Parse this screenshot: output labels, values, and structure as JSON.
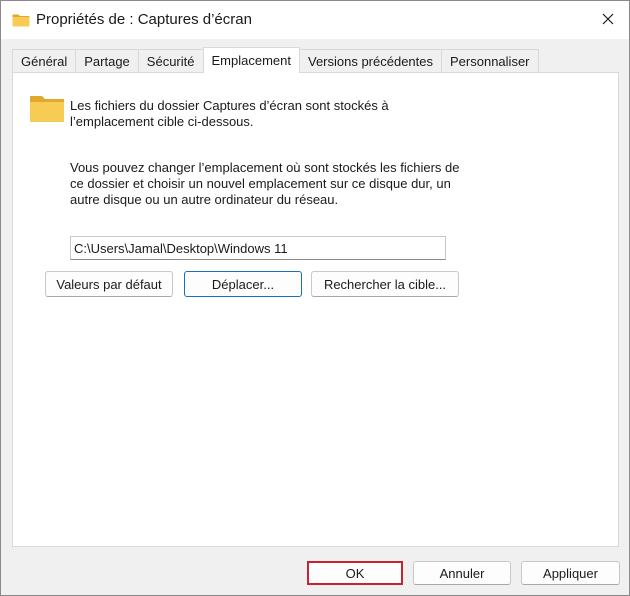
{
  "window": {
    "title": "Propriétés de : Captures d’écran"
  },
  "tabs": [
    {
      "label": "Général"
    },
    {
      "label": "Partage"
    },
    {
      "label": "Sécurité"
    },
    {
      "label": "Emplacement",
      "active": true
    },
    {
      "label": "Versions précédentes"
    },
    {
      "label": "Personnaliser"
    }
  ],
  "panel": {
    "info_text": "Les fichiers du dossier Captures d’écran sont stockés à l’emplacement cible ci-dessous.",
    "description": "Vous pouvez changer l’emplacement où sont stockés les fichiers de ce dossier et choisir un nouvel emplacement sur ce disque dur, un autre disque ou un autre ordinateur du réseau.",
    "path_value": "C:\\Users\\Jamal\\Desktop\\Windows 11",
    "buttons": {
      "default_label": "Valeurs par défaut",
      "move_label": "Déplacer...",
      "find_target_label": "Rechercher la cible..."
    }
  },
  "footer": {
    "ok_label": "OK",
    "cancel_label": "Annuler",
    "apply_label": "Appliquer"
  },
  "colors": {
    "folder": "#f5c84a",
    "focus_border": "#1a6ec0",
    "highlight_border": "#c8242f"
  },
  "icons": {
    "title": "folder-icon",
    "panel": "folder-icon",
    "close": "close-icon"
  }
}
